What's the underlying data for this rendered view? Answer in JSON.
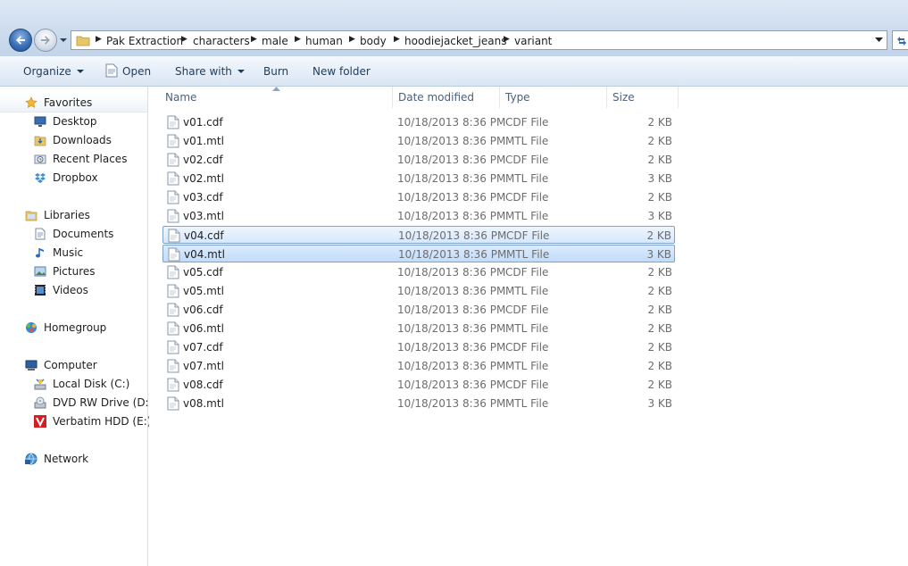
{
  "address": {
    "crumbs": [
      "Pak Extraction",
      "characters",
      "male",
      "human",
      "body",
      "hoodiejacket_jeans",
      "variant"
    ]
  },
  "toolbar": {
    "organize": "Organize",
    "open": "Open",
    "share_with": "Share with",
    "burn": "Burn",
    "new_folder": "New folder"
  },
  "nav": {
    "favorites": "Favorites",
    "desktop": "Desktop",
    "downloads": "Downloads",
    "recent_places": "Recent Places",
    "dropbox": "Dropbox",
    "libraries": "Libraries",
    "documents": "Documents",
    "music": "Music",
    "pictures": "Pictures",
    "videos": "Videos",
    "homegroup": "Homegroup",
    "computer": "Computer",
    "local_disk": "Local Disk (C:)",
    "dvd_drive": "DVD RW Drive (D:) B",
    "verbatim": "Verbatim HDD (E:)",
    "network": "Network"
  },
  "columns": {
    "name": "Name",
    "date_modified": "Date modified",
    "type": "Type",
    "size": "Size"
  },
  "files": [
    {
      "name": "v01.cdf",
      "date": "10/18/2013 8:36 PM",
      "type": "CDF File",
      "size": "2 KB",
      "state": ""
    },
    {
      "name": "v01.mtl",
      "date": "10/18/2013 8:36 PM",
      "type": "MTL File",
      "size": "2 KB",
      "state": ""
    },
    {
      "name": "v02.cdf",
      "date": "10/18/2013 8:36 PM",
      "type": "CDF File",
      "size": "2 KB",
      "state": ""
    },
    {
      "name": "v02.mtl",
      "date": "10/18/2013 8:36 PM",
      "type": "MTL File",
      "size": "3 KB",
      "state": ""
    },
    {
      "name": "v03.cdf",
      "date": "10/18/2013 8:36 PM",
      "type": "CDF File",
      "size": "2 KB",
      "state": ""
    },
    {
      "name": "v03.mtl",
      "date": "10/18/2013 8:36 PM",
      "type": "MTL File",
      "size": "3 KB",
      "state": ""
    },
    {
      "name": "v04.cdf",
      "date": "10/18/2013 8:36 PM",
      "type": "CDF File",
      "size": "2 KB",
      "state": "selected"
    },
    {
      "name": "v04.mtl",
      "date": "10/18/2013 8:36 PM",
      "type": "MTL File",
      "size": "3 KB",
      "state": "focused"
    },
    {
      "name": "v05.cdf",
      "date": "10/18/2013 8:36 PM",
      "type": "CDF File",
      "size": "2 KB",
      "state": ""
    },
    {
      "name": "v05.mtl",
      "date": "10/18/2013 8:36 PM",
      "type": "MTL File",
      "size": "2 KB",
      "state": ""
    },
    {
      "name": "v06.cdf",
      "date": "10/18/2013 8:36 PM",
      "type": "CDF File",
      "size": "2 KB",
      "state": ""
    },
    {
      "name": "v06.mtl",
      "date": "10/18/2013 8:36 PM",
      "type": "MTL File",
      "size": "2 KB",
      "state": ""
    },
    {
      "name": "v07.cdf",
      "date": "10/18/2013 8:36 PM",
      "type": "CDF File",
      "size": "2 KB",
      "state": ""
    },
    {
      "name": "v07.mtl",
      "date": "10/18/2013 8:36 PM",
      "type": "MTL File",
      "size": "2 KB",
      "state": ""
    },
    {
      "name": "v08.cdf",
      "date": "10/18/2013 8:36 PM",
      "type": "CDF File",
      "size": "2 KB",
      "state": ""
    },
    {
      "name": "v08.mtl",
      "date": "10/18/2013 8:36 PM",
      "type": "MTL File",
      "size": "3 KB",
      "state": ""
    }
  ],
  "icons": {
    "back": "back-arrow-icon",
    "forward": "forward-arrow-icon",
    "folder": "folder-icon",
    "file": "document-file-icon",
    "refresh": "refresh-icon"
  },
  "colors": {
    "selection_border": "#7da2ce",
    "selection_fill": "#d6e8fb",
    "accent": "#1e3b5c"
  }
}
